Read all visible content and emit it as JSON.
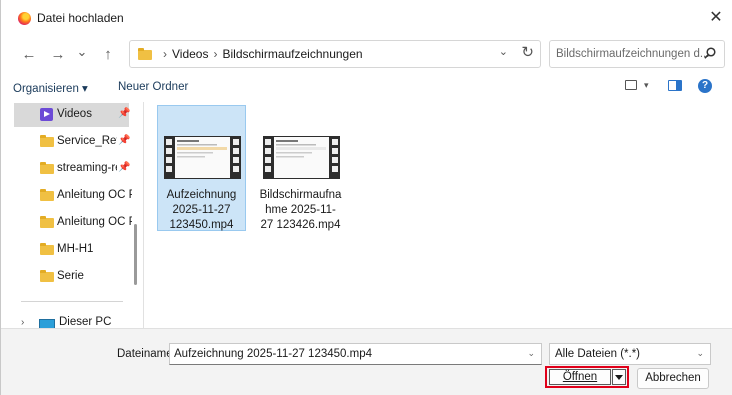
{
  "window": {
    "title": "Datei hochladen",
    "app_icon": "firefox-icon",
    "close_glyph": "✕"
  },
  "navigation": {
    "back_glyph": "←",
    "forward_glyph": "→",
    "recent_glyph": "⌄",
    "up_glyph": "↑",
    "breadcrumb": [
      "Videos",
      "Bildschirmaufzeichnungen"
    ],
    "breadcrumb_separator": "›",
    "dropdown_glyph": "⌄",
    "refresh_glyph": "↻",
    "search_placeholder": "Bildschirmaufzeichnungen d..."
  },
  "toolbar": {
    "organize_label": "Organisieren ▾",
    "new_folder_label": "Neuer Ordner",
    "view_dropdown_glyph": "▾",
    "help_glyph": "?"
  },
  "sidebar": {
    "items": [
      {
        "label": "Videos",
        "icon": "videos-icon",
        "pinned": true,
        "selected": true
      },
      {
        "label": "Service_Revie",
        "icon": "folder-icon",
        "pinned": true
      },
      {
        "label": "streaming-re",
        "icon": "folder-icon",
        "pinned": true
      },
      {
        "label": "Anleitung OC Pl",
        "icon": "folder-icon"
      },
      {
        "label": "Anleitung OC Pl",
        "icon": "folder-icon"
      },
      {
        "label": "MH-H1",
        "icon": "folder-icon"
      },
      {
        "label": "Serie",
        "icon": "folder-icon"
      }
    ],
    "pin_glyph": "📌",
    "this_pc": {
      "label": "Dieser PC",
      "chevron": "›"
    }
  },
  "files": [
    {
      "name": "Aufzeichnung 2025-11-27 123450.mp4",
      "selected": true
    },
    {
      "name": "Bildschirmaufnahme 2025-11-27 123426.mp4",
      "selected": false
    }
  ],
  "bottom": {
    "filename_label": "Dateiname:",
    "filename_value": "Aufzeichnung 2025-11-27 123450.mp4",
    "filename_dropdown_glyph": "⌄",
    "file_type_value": "Alle Dateien (*.*)",
    "file_type_dropdown_glyph": "⌄",
    "open_label": "Öffnen",
    "cancel_label": "Abbrechen"
  },
  "colors": {
    "selection_fill": "#cce4f7",
    "selection_border": "#99c9ef",
    "accent": "#2b74c9",
    "highlight_frame": "#e0001a"
  }
}
